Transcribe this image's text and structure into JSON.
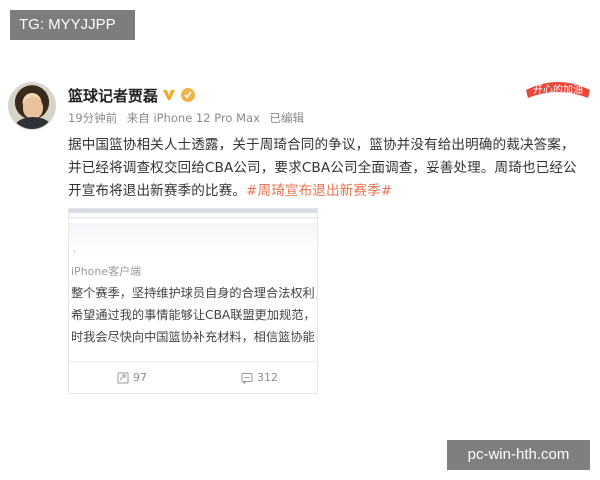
{
  "overlay": {
    "tg_label": "TG: MYYJJPP",
    "watermark": "pc-win-hth.com"
  },
  "post": {
    "author": "篮球记者贾磊",
    "time": "19分钟前",
    "source": "来自 iPhone 12 Pro Max",
    "edited": "已编辑",
    "text_main": "据中国篮协相关人士透露，关于周琦合同的争议，篮协并没有给出明确的裁决答案，并已经将调查权交回给CBA公司，要求CBA公司全面调查，妥善处理。周琦也已经公开宣布将退出新赛季的比赛。",
    "hashtag": "#周琦宣布退出新赛季#",
    "badge_text": "开心的加油"
  },
  "embedded": {
    "dot": "·",
    "source_hint": "iPhone客户端",
    "line1": "整个赛季，坚持维护球员自身的合理合法权利，",
    "line2": "希望通过我的事情能够让CBA联盟更加规范，",
    "line3": "时我会尽快向中国篮协补充材料，相信篮协能",
    "repost_count": "97",
    "comment_count": "312"
  },
  "colors": {
    "hashtag": "#eb7350",
    "verified": "#f5a623",
    "badge": "#e8473c"
  },
  "icons": [
    "verified-v-icon",
    "fan-badge-icon",
    "repost-icon",
    "comment-icon"
  ]
}
